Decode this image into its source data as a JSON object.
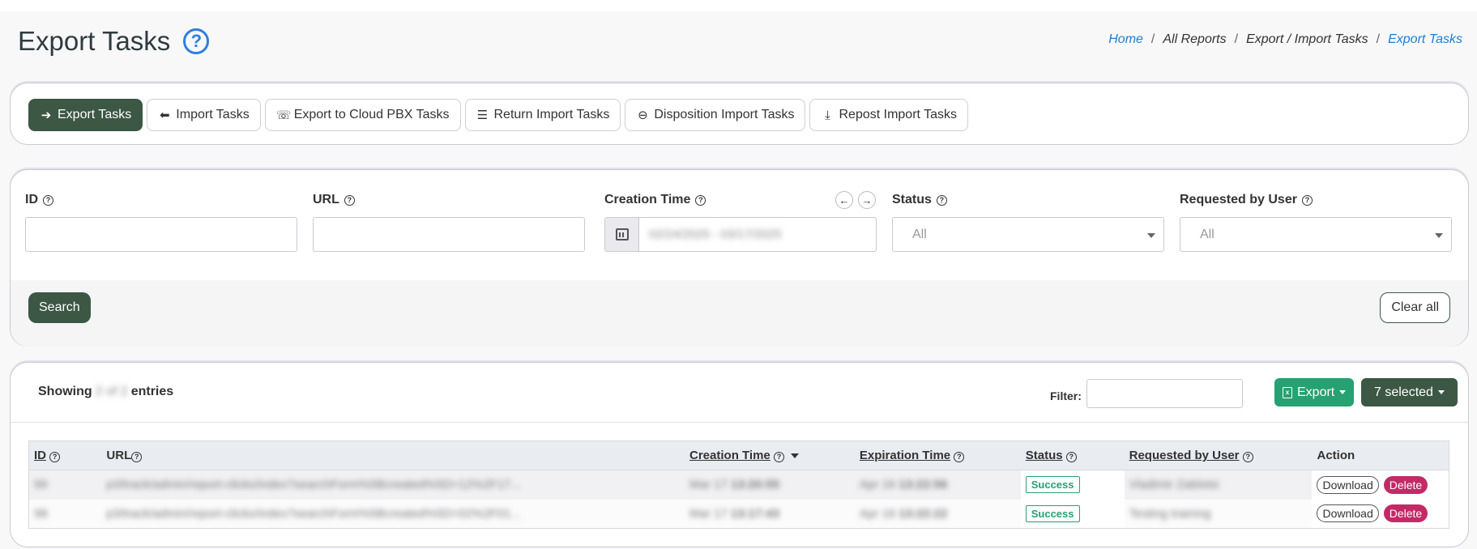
{
  "header": {
    "title": "Export Tasks",
    "help_glyph": "?",
    "breadcrumb": [
      "Home",
      "All Reports",
      "Export / Import Tasks",
      "Export Tasks"
    ],
    "breadcrumb_sep": "/"
  },
  "tabs": [
    {
      "label": "Export Tasks",
      "icon": "arrow-right-circle-icon",
      "active": true
    },
    {
      "label": "Import Tasks",
      "icon": "arrow-left-circle-icon",
      "active": false
    },
    {
      "label": "Export to Cloud PBX Tasks",
      "icon": "phone-volume-icon",
      "active": false
    },
    {
      "label": "Return Import Tasks",
      "icon": "list-icon",
      "active": false
    },
    {
      "label": "Disposition Import Tasks",
      "icon": "arrow-left-circle-outline-icon",
      "active": false
    },
    {
      "label": "Repost Import Tasks",
      "icon": "inbox-download-icon",
      "active": false
    }
  ],
  "filters": {
    "id_label": "ID",
    "url_label": "URL",
    "creation_time_label": "Creation Time",
    "creation_time_value": "02/24/2025 - 03/17/2025",
    "status_label": "Status",
    "status_value": "All",
    "requested_by_label": "Requested by User",
    "requested_by_value": "All",
    "search_button": "Search",
    "clear_button": "Clear all"
  },
  "table_controls": {
    "showing_prefix": "Showing",
    "showing_range": "2 of 2",
    "showing_suffix": "entries",
    "filter_label": "Filter:",
    "export_button": "Export",
    "selected_button": "7 selected"
  },
  "table": {
    "columns": [
      "ID",
      "URL",
      "Creation Time",
      "Expiration Time",
      "Status",
      "Requested by User",
      "Action"
    ],
    "rows": [
      {
        "id": "99",
        "url": "p3/track/admin/report-clicks/index?searchForm%5Bcreated%5D=12%2F17...",
        "created_date": "Mar 17",
        "created_time": "13:20:55",
        "expires_date": "Apr 16",
        "expires_time": "13:22:56",
        "status": "Success",
        "user": "Vladimir Zablotsi",
        "download": "Download",
        "delete": "Delete"
      },
      {
        "id": "98",
        "url": "p3/track/admin/report-clicks/index?searchForm%5Bcreated%5D=02%2F01...",
        "created_date": "Mar 17",
        "created_time": "13:17:43",
        "expires_date": "Apr 16",
        "expires_time": "13:22:22",
        "status": "Success",
        "user": "Testing training",
        "download": "Download",
        "delete": "Delete"
      }
    ]
  },
  "colors": {
    "primary_dark_green": "#3c5744",
    "export_green": "#26a172",
    "delete_pink": "#c22a66",
    "link_blue": "#1a7fd6"
  }
}
